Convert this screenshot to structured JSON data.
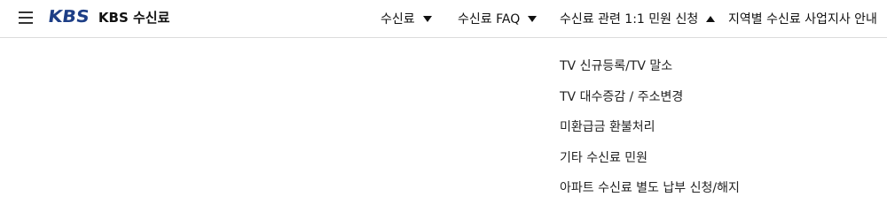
{
  "header": {
    "logo_mark": "KBS",
    "logo_text": "KBS 수신료"
  },
  "nav": [
    {
      "label": "수신료",
      "caret": "chevron-down-icon"
    },
    {
      "label": "수신료 FAQ",
      "caret": "chevron-down-icon"
    },
    {
      "label": "수신료 관련 1:1 민원 신청",
      "caret": "chevron-up-icon"
    },
    {
      "label": "지역별 수신료 사업지사 안내"
    }
  ],
  "dropdown": {
    "items": [
      "TV 신규등록/TV 말소",
      "TV 대수증감 / 주소변경",
      "미환급금 환불처리",
      "기타 수신료 민원",
      "아파트 수신료 별도 납부 신청/해지"
    ]
  },
  "colors": {
    "brand": "#1d3e86",
    "text": "#111111",
    "divider": "#dcdcdc"
  }
}
